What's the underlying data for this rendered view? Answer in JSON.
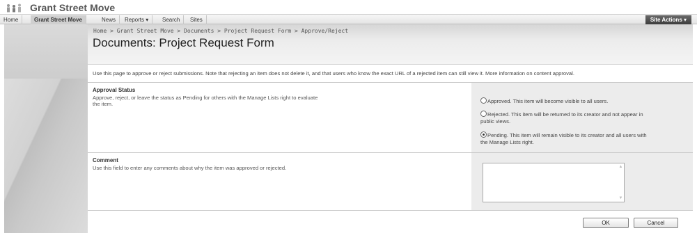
{
  "site": {
    "title": "Grant Street Move",
    "logo_icon": "people-logo-icon"
  },
  "nav": {
    "items": [
      {
        "label": "Home",
        "active": false
      },
      {
        "label": "Grant Street Move",
        "active": true
      },
      {
        "label": "News",
        "active": false
      },
      {
        "label": "Reports ▾",
        "active": false
      },
      {
        "label": "Search",
        "active": false
      },
      {
        "label": "Sites",
        "active": false
      }
    ],
    "site_actions": "Site Actions ▾"
  },
  "header": {
    "breadcrumb": "Home > Grant Street Move > Documents > Project Request Form > Approve/Reject",
    "page_title": "Documents: Project Request Form"
  },
  "main": {
    "intro": "Use this page to approve or reject submissions. Note that rejecting an item does not delete it, and that users who know the exact URL of a rejected item can still view it. More information on content approval.",
    "approval": {
      "heading": "Approval Status",
      "desc_line1": "Approve, reject, or leave the status as Pending for others with the Manage Lists right to evaluate",
      "desc_line2": "the item.",
      "options": [
        {
          "line1": "Approved. This item will become visible to all users.",
          "line2": "",
          "checked": false
        },
        {
          "line1": "Rejected. This item will be returned to its creator and not appear in",
          "line2": "public views.",
          "checked": false
        },
        {
          "line1": "Pending. This item will remain visible to its creator and all users with",
          "line2": "the Manage Lists right.",
          "checked": true
        }
      ]
    },
    "comment": {
      "heading": "Comment",
      "desc": "Use this field to enter any comments about why the item was approved or rejected.",
      "value": ""
    },
    "buttons": {
      "ok": "OK",
      "cancel": "Cancel"
    }
  },
  "colors": {
    "site_actions_bg": "#4a4a4a",
    "active_tab_bg": "#cfcfcf",
    "option_panel_bg": "#ececec"
  }
}
